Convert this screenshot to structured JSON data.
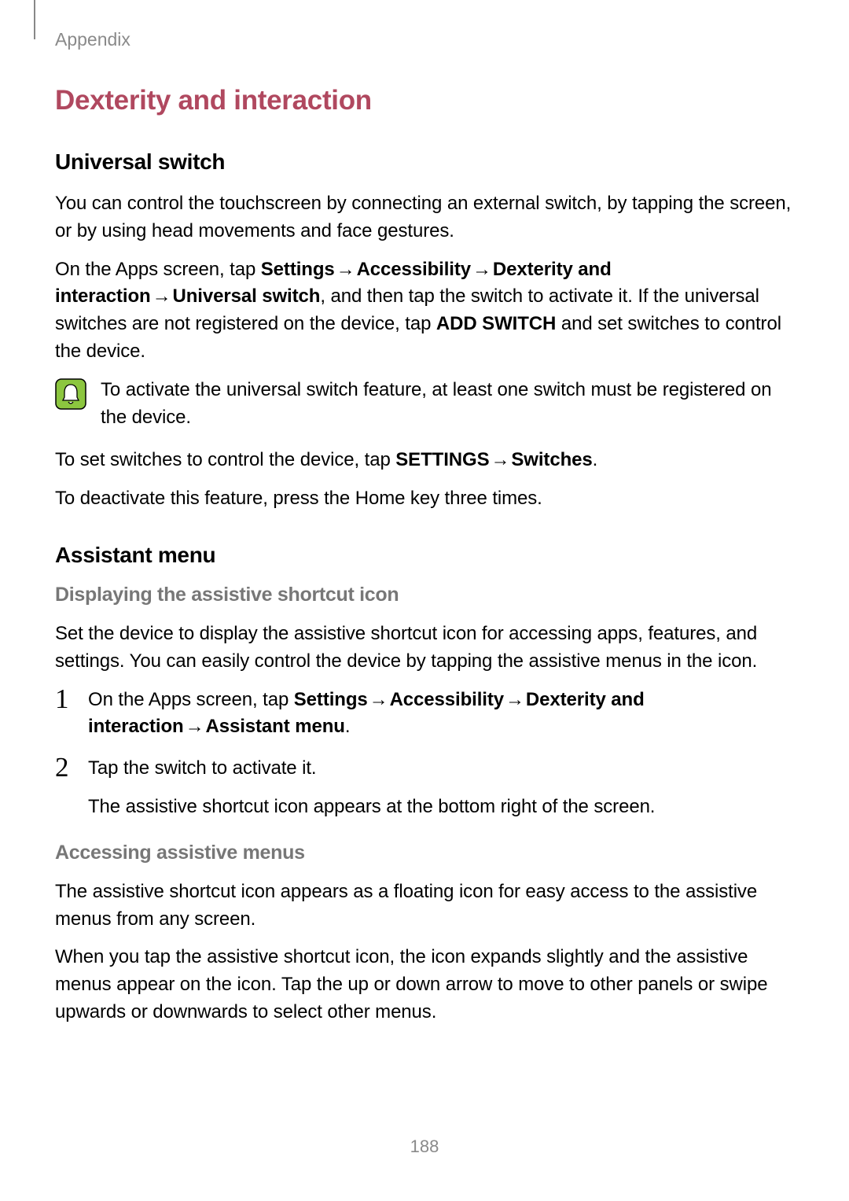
{
  "header": {
    "section_label": "Appendix"
  },
  "section": {
    "title": "Dexterity and interaction"
  },
  "universal_switch": {
    "heading": "Universal switch",
    "p1": "You can control the touchscreen by connecting an external switch, by tapping the screen, or by using head movements and face gestures.",
    "p2_pre": "On the Apps screen, tap ",
    "p2_path1": "Settings",
    "p2_path2": "Accessibility",
    "p2_path3": "Dexterity and interaction",
    "p2_path4": "Universal switch",
    "p2_mid": ", and then tap the switch to activate it. If the universal switches are not registered on the device, tap ",
    "p2_add_switch": "ADD SWITCH",
    "p2_end": " and set switches to control the device.",
    "note": "To activate the universal switch feature, at least one switch must be registered on the device.",
    "p3_pre": "To set switches to control the device, tap ",
    "p3_settings": "SETTINGS",
    "p3_switches": "Switches",
    "p3_end": ".",
    "p4": "To deactivate this feature, press the Home key three times."
  },
  "assistant_menu": {
    "heading": "Assistant menu",
    "sub1": "Displaying the assistive shortcut icon",
    "p1": "Set the device to display the assistive shortcut icon for accessing apps, features, and settings. You can easily control the device by tapping the assistive menus in the icon.",
    "step1_pre": "On the Apps screen, tap ",
    "step1_path1": "Settings",
    "step1_path2": "Accessibility",
    "step1_path3": "Dexterity and interaction",
    "step1_path4": "Assistant menu",
    "step1_end": ".",
    "step2_a": "Tap the switch to activate it.",
    "step2_b": "The assistive shortcut icon appears at the bottom right of the screen.",
    "sub2": "Accessing assistive menus",
    "p2": "The assistive shortcut icon appears as a floating icon for easy access to the assistive menus from any screen.",
    "p3": "When you tap the assistive shortcut icon, the icon expands slightly and the assistive menus appear on the icon. Tap the up or down arrow to move to other panels or swipe upwards or downwards to select other menus."
  },
  "glyphs": {
    "arrow": "→"
  },
  "digits": {
    "one": "1",
    "two": "2"
  },
  "page_number": "188"
}
